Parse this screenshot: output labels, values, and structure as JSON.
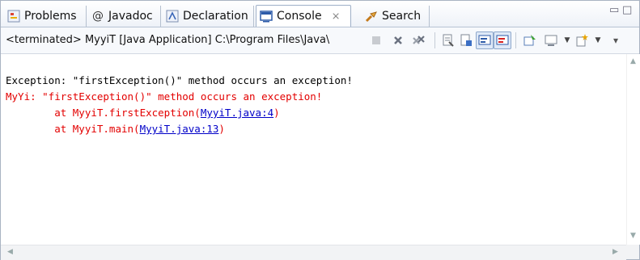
{
  "tabs": [
    {
      "label": "Problems",
      "icon": "problems-icon",
      "active": false
    },
    {
      "label": "Javadoc",
      "icon": "at-icon",
      "active": false
    },
    {
      "label": "Declaration",
      "icon": "declaration-icon",
      "active": false
    },
    {
      "label": "Console",
      "icon": "console-icon",
      "active": true
    },
    {
      "label": "Search",
      "icon": "search-flashlight-icon",
      "active": false
    }
  ],
  "tab_close_glyph": "⨯",
  "window_controls": {
    "minimize": "▭",
    "maximize": "□"
  },
  "toolbar": {
    "path_text": "<terminated> MyyiT [Java Application] C:\\Program Files\\Java\\",
    "icons": [
      "terminate-icon",
      "remove-launch-icon",
      "remove-all-terminated-icon",
      "clear-console-icon",
      "scroll-lock-icon",
      "show-console-on-stdout-icon",
      "show-console-on-stderr-icon",
      "pin-console-icon",
      "display-selected-console-icon",
      "open-console-icon"
    ]
  },
  "console": {
    "line1": "Exception: \"firstException()\" method occurs an exception!",
    "line2": "MyYi: \"firstException()\" method occurs an exception!",
    "line3_prefix": "        at MyyiT.firstException(",
    "line3_link": "MyyiT.java:4",
    "line3_suffix": ")",
    "line4_prefix": "        at MyyiT.main(",
    "line4_link": "MyyiT.java:13",
    "line4_suffix": ")"
  },
  "colors": {
    "stdout": "#000000",
    "stderr": "#e30000",
    "link": "#0000c8"
  }
}
